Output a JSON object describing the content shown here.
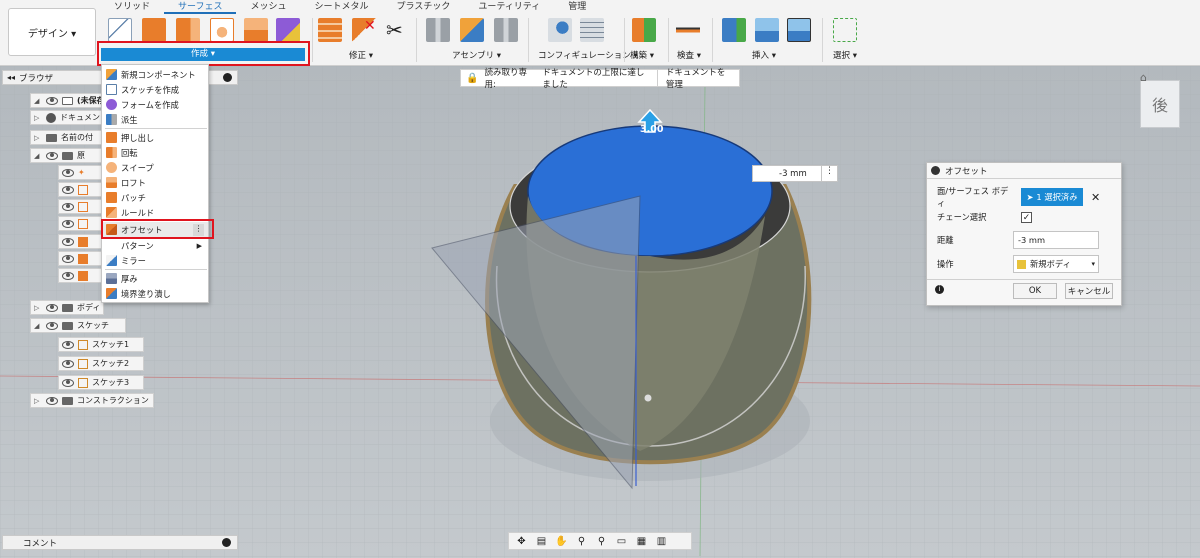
{
  "toolbar": {
    "design_label": "デザイン ▾",
    "tabs": [
      "ソリッド",
      "サーフェス",
      "メッシュ",
      "シートメタル",
      "プラスチック",
      "ユーティリティ",
      "管理"
    ],
    "groups": {
      "create": "作成 ▾",
      "modify": "修正 ▾",
      "assemble": "アセンブリ ▾",
      "config": "コンフィギュレーション ▾",
      "construct": "構築 ▾",
      "inspect": "検査 ▾",
      "insert": "挿入 ▾",
      "select": "選択 ▾"
    }
  },
  "browser": {
    "title": "ブラウザ",
    "items": [
      "(未保存)",
      "ドキュメント",
      "名前の付",
      "原",
      "ボディ",
      "スケッチ",
      "スケッチ1",
      "スケッチ2",
      "スケッチ3",
      "コンストラクション"
    ]
  },
  "create_menu": {
    "items": [
      "新規コンポーネント",
      "スケッチを作成",
      "フォームを作成",
      "派生",
      "押し出し",
      "回転",
      "スイープ",
      "ロフト",
      "パッチ",
      "ルールド",
      "オフセット",
      "パターン",
      "ミラー",
      "厚み",
      "境界塗り潰し"
    ]
  },
  "banner": {
    "readonly": "読み取り専用:",
    "message": "ドキュメントの上限に達しました",
    "manage": "ドキュメントを管理"
  },
  "viewcube_label": "後",
  "distance_field": "-3 mm",
  "height_label": "3.00",
  "offset_dialog": {
    "title": "オフセット",
    "faces_label": "面/サーフェス ボディ",
    "faces_value": "1 選択済み",
    "chain_label": "チェーン選択",
    "distance_label": "距離",
    "distance_value": "-3 mm",
    "operation_label": "操作",
    "operation_value": "新規ボディ",
    "ok": "OK",
    "cancel": "キャンセル"
  },
  "comments_label": "コメント",
  "colors": {
    "accent": "#1a8ad4",
    "highlight": "#e0141e",
    "body": "#6f7360",
    "face": "#2a6fd6"
  }
}
